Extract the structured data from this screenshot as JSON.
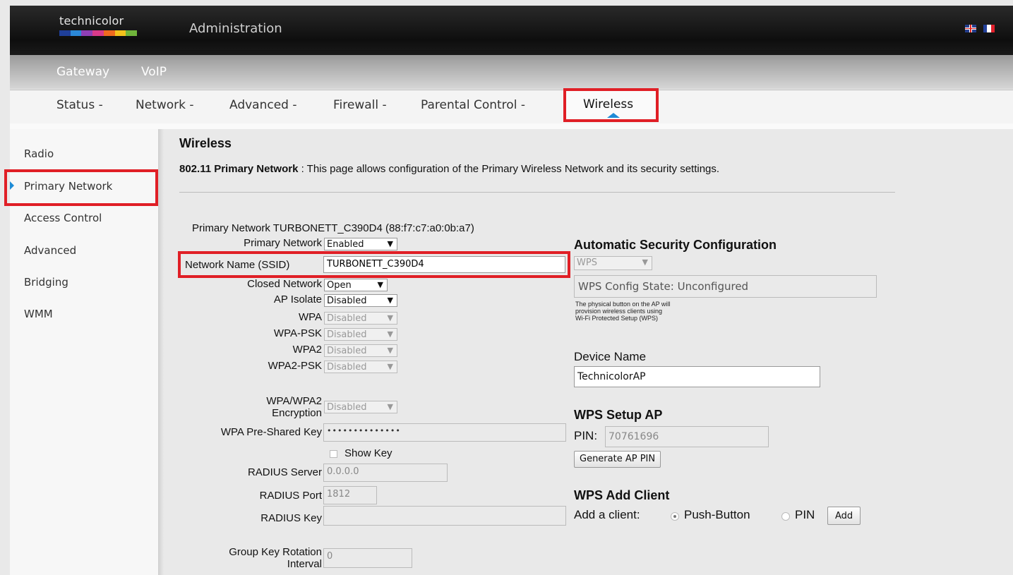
{
  "header": {
    "brand": "technicolor",
    "brand_colors": [
      "#1f3f99",
      "#2b88d8",
      "#8f3fb5",
      "#d93a8a",
      "#f06a1f",
      "#f4c21c",
      "#70b53b"
    ],
    "title": "Administration",
    "flags": [
      "uk-flag-icon",
      "fr-flag-icon"
    ]
  },
  "nav_primary": {
    "items": [
      {
        "label": "Gateway"
      },
      {
        "label": "VoIP"
      }
    ]
  },
  "nav_secondary": {
    "items": [
      {
        "label": "Status -"
      },
      {
        "label": "Network -"
      },
      {
        "label": "Advanced -"
      },
      {
        "label": "Firewall -"
      },
      {
        "label": "Parental Control -"
      },
      {
        "label": "Wireless"
      }
    ],
    "active": "Wireless"
  },
  "sidebar": {
    "items": [
      {
        "label": "Radio"
      },
      {
        "label": "Primary Network"
      },
      {
        "label": "Access Control"
      },
      {
        "label": "Advanced"
      },
      {
        "label": "Bridging"
      },
      {
        "label": "WMM"
      }
    ],
    "active": "Primary Network"
  },
  "page": {
    "heading": "Wireless",
    "desc_bold": "802.11 Primary Network",
    "desc_text": " :  This page allows configuration of the Primary Wireless Network and its security settings."
  },
  "form": {
    "network_title": "Primary Network TURBONETT_C390D4 (88:f7:c7:a0:0b:a7)",
    "primary_network": {
      "label": "Primary Network",
      "value": "Enabled"
    },
    "ssid": {
      "label": "Network Name (SSID)",
      "value": "TURBONETT_C390D4"
    },
    "closed_network": {
      "label": "Closed Network",
      "value": "Open"
    },
    "ap_isolate": {
      "label": "AP Isolate",
      "value": "Disabled"
    },
    "wpa": {
      "label": "WPA",
      "value": "Disabled"
    },
    "wpa_psk": {
      "label": "WPA-PSK",
      "value": "Disabled"
    },
    "wpa2": {
      "label": "WPA2",
      "value": "Disabled"
    },
    "wpa2_psk": {
      "label": "WPA2-PSK",
      "value": "Disabled"
    },
    "encryption": {
      "label_line1": "WPA/WPA2",
      "label_line2": "Encryption",
      "value": "Disabled"
    },
    "psk": {
      "label": "WPA Pre-Shared Key",
      "value": "••••••••••••••"
    },
    "show_key": {
      "label": "Show Key"
    },
    "radius_server": {
      "label": "RADIUS Server",
      "value": "0.0.0.0"
    },
    "radius_port": {
      "label": "RADIUS Port",
      "value": "1812"
    },
    "radius_key": {
      "label": "RADIUS Key",
      "value": ""
    },
    "group_key": {
      "label_line1": "Group Key Rotation",
      "label_line2": "Interval",
      "value": "0"
    }
  },
  "wps": {
    "heading": "Automatic Security Configuration",
    "mode": "WPS",
    "config_state": "WPS Config State: Unconfigured",
    "note": [
      "The physical button on the AP will",
      "provision wireless clients using",
      "Wi-Fi Protected Setup (WPS)"
    ],
    "device_name_label": "Device Name",
    "device_name": "TechnicolorAP",
    "setup_heading": "WPS Setup AP",
    "pin_label": "PIN:",
    "pin_value": "70761696",
    "generate_btn": "Generate AP PIN",
    "add_client_heading": "WPS Add Client",
    "add_client_label": "Add a client:",
    "push_button": "Push-Button",
    "pin_option": "PIN",
    "add_btn": "Add"
  }
}
